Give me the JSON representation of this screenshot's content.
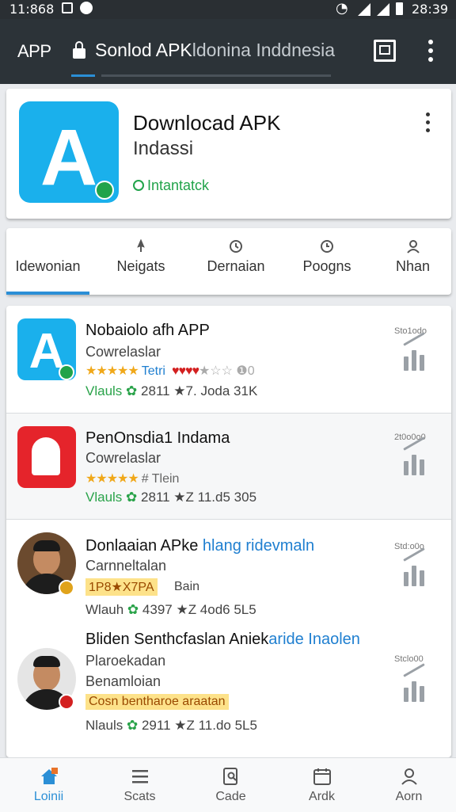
{
  "status_bar": {
    "time": "11:868",
    "clock_right": "28:39"
  },
  "app_bar": {
    "label": "APP",
    "url_main": "Sonlod APK",
    "url_rest": "ldonina Inddnesia"
  },
  "header": {
    "title": "Downlocad APK",
    "subtitle": "Indassi",
    "status": "Intantatck"
  },
  "tabs": [
    {
      "label": "Idewonian",
      "icon": ""
    },
    {
      "label": "Neigats",
      "icon": "pin-icon"
    },
    {
      "label": "Dernaian",
      "icon": "clock-icon"
    },
    {
      "label": "Poogns",
      "icon": "clock-icon"
    },
    {
      "label": "Nhan",
      "icon": "person-icon"
    }
  ],
  "list": [
    {
      "name": "Nobaiolo afh APP",
      "sub": "Cowrelaslar",
      "stars": "★★★★★",
      "rating_text": "Tetri",
      "red_stars": "♥♥♥♥",
      "gray_stars": "★☆☆ ❶0",
      "stats_prefix": "Vlauls",
      "stats": "2811 ★7. Joda 31K",
      "size": "Sto1odo"
    },
    {
      "name": "PenOnsdia1 Indama",
      "sub": "Cowrelaslar",
      "stars": "★★★★★",
      "rating_text": "# Tlein",
      "stats_prefix": "Vlauls",
      "stats": "2811 ★Z 11.d5 305",
      "size": "2t0o0o0"
    },
    {
      "name": "Donlaaian APke",
      "name_blue": "hlang ridevmaln",
      "sub": "Carnneltalan",
      "highlight": "1P8★X7PA",
      "highlight_after": "Bain",
      "stats_prefix": "Wlauh",
      "stats": "4397 ★Z 4od6 5L5",
      "size": "Std:o0o"
    },
    {
      "name": "Bliden Senthcfaslan Aniek",
      "name_blue": "aride Inaolen",
      "sub": "Plaroekadan",
      "sub2": "Benamloian",
      "highlight": "Cosn bentharoe araatan",
      "stats_prefix": "Nlauls",
      "stats": "2911 ★Z 11.do 5L5",
      "size": "Stclo00"
    }
  ],
  "bottom_nav": [
    {
      "label": "Loinii",
      "icon": "home-icon"
    },
    {
      "label": "Scats",
      "icon": "menu-icon"
    },
    {
      "label": "Cade",
      "icon": "search-doc-icon"
    },
    {
      "label": "Ardk",
      "icon": "calendar-icon"
    },
    {
      "label": "Aorn",
      "icon": "person-icon"
    }
  ]
}
